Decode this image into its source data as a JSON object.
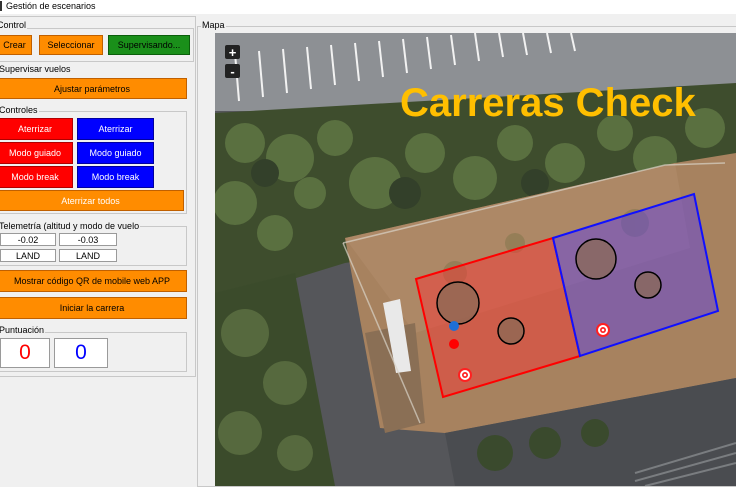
{
  "window": {
    "title": "Gestión de escenarios"
  },
  "control": {
    "label": "Control",
    "crear": "Crear",
    "seleccionar": "Seleccionar",
    "supervisando": "Supervisando..."
  },
  "supervisar": {
    "label": "Supervisar vuelos",
    "ajustar": "Ajustar parámetros"
  },
  "controles": {
    "label": "Controles",
    "aterrizar": "Aterrizar",
    "modo_guiado": "Modo guiado",
    "modo_break": "Modo break",
    "aterrizar_todos": "Aterrizar todos"
  },
  "telemetria": {
    "label": "Telemetría (altitud y modo de vuelo",
    "red_alt": "-0.02",
    "blue_alt": "-0.03",
    "red_mode": "LAND",
    "blue_mode": "LAND"
  },
  "qr_button": "Mostrar código QR de mobile web APP",
  "iniciar_button": "Iniciar la carrera",
  "puntuacion": {
    "label": "Puntuación",
    "red": "0",
    "blue": "0"
  },
  "mapa": {
    "label": "Mapa",
    "zoom_in": "+",
    "zoom_out": "-",
    "title": "Carreras Check"
  },
  "colors": {
    "orange": "#ff8c00",
    "green": "#1a8f1a",
    "red": "#ff0000",
    "blue": "#0000ff",
    "map_title": "#ffbf00"
  }
}
